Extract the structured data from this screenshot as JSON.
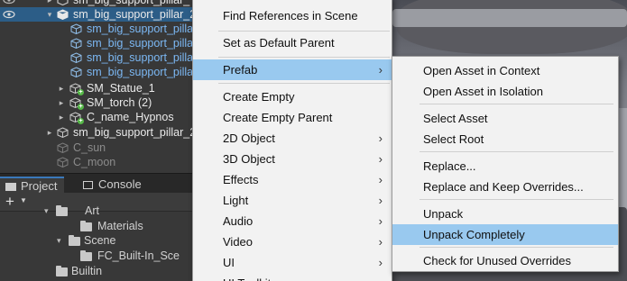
{
  "hierarchy": {
    "rows": [
      {
        "label": "sm_big_support_pillar_",
        "style": "white"
      },
      {
        "label": "sm_big_support_pillar_2",
        "style": "white"
      },
      {
        "label": "sm_big_support_pillar",
        "style": "blue"
      },
      {
        "label": "sm_big_support_pillar",
        "style": "blue"
      },
      {
        "label": "sm_big_support_pillar",
        "style": "blue"
      },
      {
        "label": "sm_big_support_pillar",
        "style": "blue"
      },
      {
        "label": "SM_Statue_1",
        "style": "white"
      },
      {
        "label": "SM_torch (2)",
        "style": "white"
      },
      {
        "label": "C_name_Hypnos",
        "style": "white"
      },
      {
        "label": "sm_big_support_pillar_2",
        "style": "white"
      },
      {
        "label": "C_sun",
        "style": "grey"
      },
      {
        "label": "C_moon",
        "style": "grey"
      }
    ]
  },
  "project": {
    "tabs": [
      {
        "label": "Project",
        "icon": "folder-icon"
      },
      {
        "label": "Console",
        "icon": "console-icon"
      }
    ],
    "add_label": "+",
    "tree": [
      {
        "label": "Art"
      },
      {
        "label": "Materials"
      },
      {
        "label": "Scene"
      },
      {
        "label": "FC_Built-In_Sce"
      },
      {
        "label": "Builtin"
      }
    ]
  },
  "context_menu": {
    "items": [
      {
        "label": "Find References in Scene"
      },
      {
        "label": "Set as Default Parent"
      },
      {
        "label": "Prefab",
        "submenu": true,
        "highlighted": true
      },
      {
        "label": "Create Empty"
      },
      {
        "label": "Create Empty Parent"
      },
      {
        "label": "2D Object",
        "submenu": true
      },
      {
        "label": "3D Object",
        "submenu": true
      },
      {
        "label": "Effects",
        "submenu": true
      },
      {
        "label": "Light",
        "submenu": true
      },
      {
        "label": "Audio",
        "submenu": true
      },
      {
        "label": "Video",
        "submenu": true
      },
      {
        "label": "UI",
        "submenu": true
      },
      {
        "label": "UI Toolkit",
        "submenu": true
      }
    ]
  },
  "prefab_submenu": {
    "items": [
      {
        "label": "Open Asset in Context"
      },
      {
        "label": "Open Asset in Isolation"
      },
      {
        "label": "Select Asset"
      },
      {
        "label": "Select Root"
      },
      {
        "label": "Replace..."
      },
      {
        "label": "Replace and Keep Overrides..."
      },
      {
        "label": "Unpack"
      },
      {
        "label": "Unpack Completely",
        "highlighted": true
      },
      {
        "label": "Check for Unused Overrides"
      }
    ]
  },
  "colors": {
    "selection_blue": "#2c5d87",
    "prefab_blue": "#7cb8f4",
    "menu_highlight": "#99c9ef",
    "menu_bg": "#f2f2f2"
  }
}
